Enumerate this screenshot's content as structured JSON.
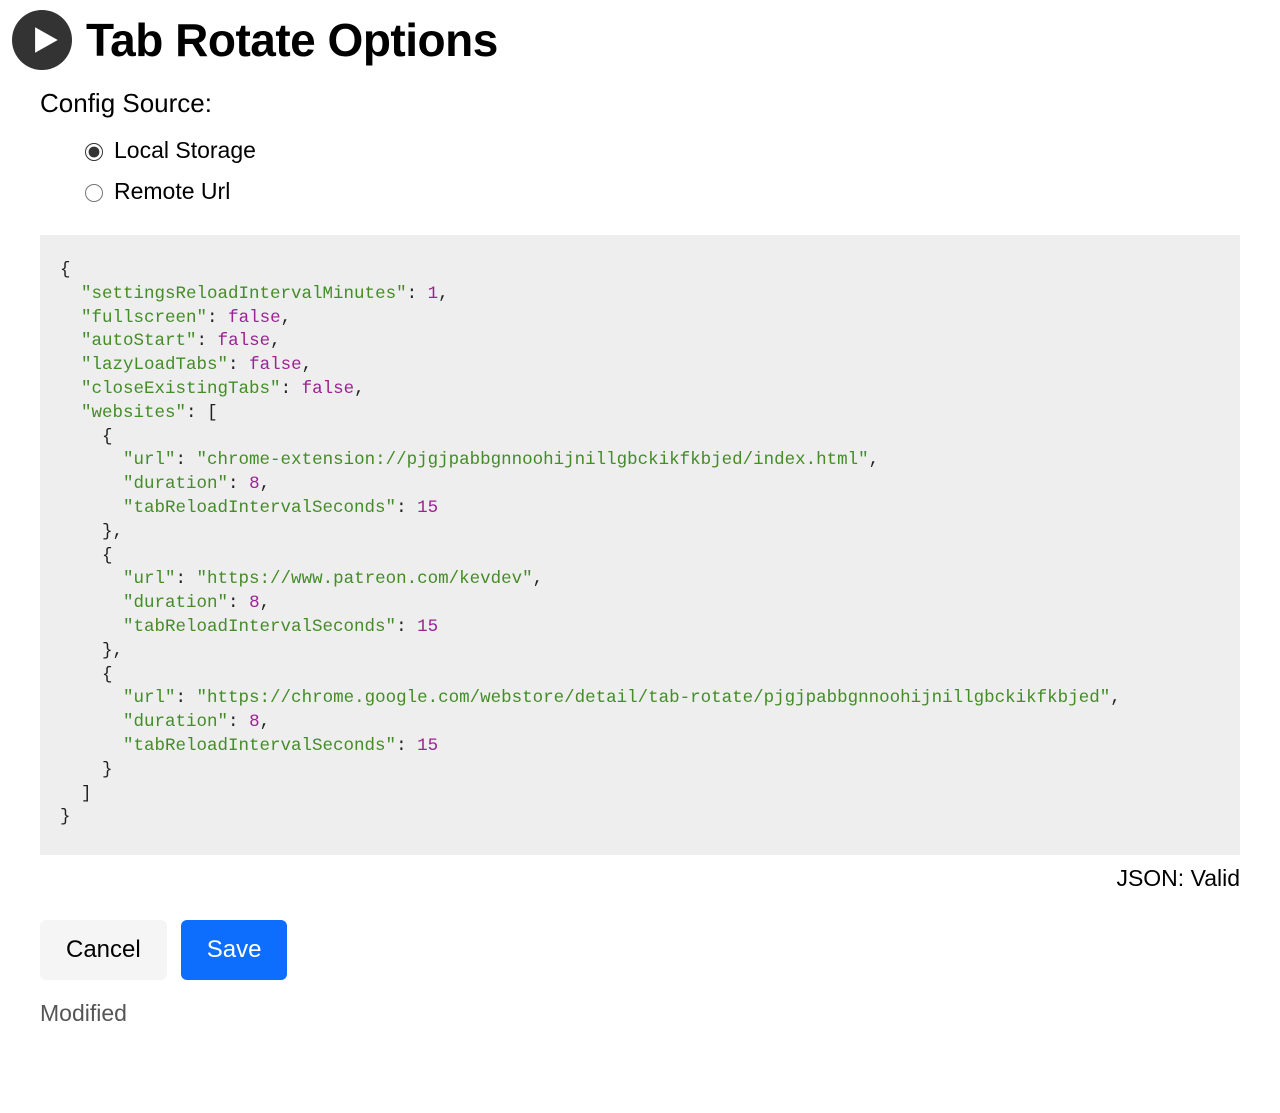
{
  "header": {
    "title": "Tab Rotate Options"
  },
  "configSource": {
    "label": "Config Source:",
    "options": [
      {
        "label": "Local Storage",
        "value": "local",
        "selected": true
      },
      {
        "label": "Remote Url",
        "value": "remote",
        "selected": false
      }
    ]
  },
  "configJson": {
    "settingsReloadIntervalMinutes": 1,
    "fullscreen": false,
    "autoStart": false,
    "lazyLoadTabs": false,
    "closeExistingTabs": false,
    "websites": [
      {
        "url": "chrome-extension://pjgjpabbgnnoohijnillgbckikfkbjed/index.html",
        "duration": 8,
        "tabReloadIntervalSeconds": 15
      },
      {
        "url": "https://www.patreon.com/kevdev",
        "duration": 8,
        "tabReloadIntervalSeconds": 15
      },
      {
        "url": "https://chrome.google.com/webstore/detail/tab-rotate/pjgjpabbgnnoohijnillgbckikfkbjed",
        "duration": 8,
        "tabReloadIntervalSeconds": 15
      }
    ]
  },
  "status": {
    "jsonLabel": "JSON:",
    "jsonValue": "Valid"
  },
  "buttons": {
    "cancel": "Cancel",
    "save": "Save"
  },
  "footer": {
    "modified": "Modified"
  }
}
